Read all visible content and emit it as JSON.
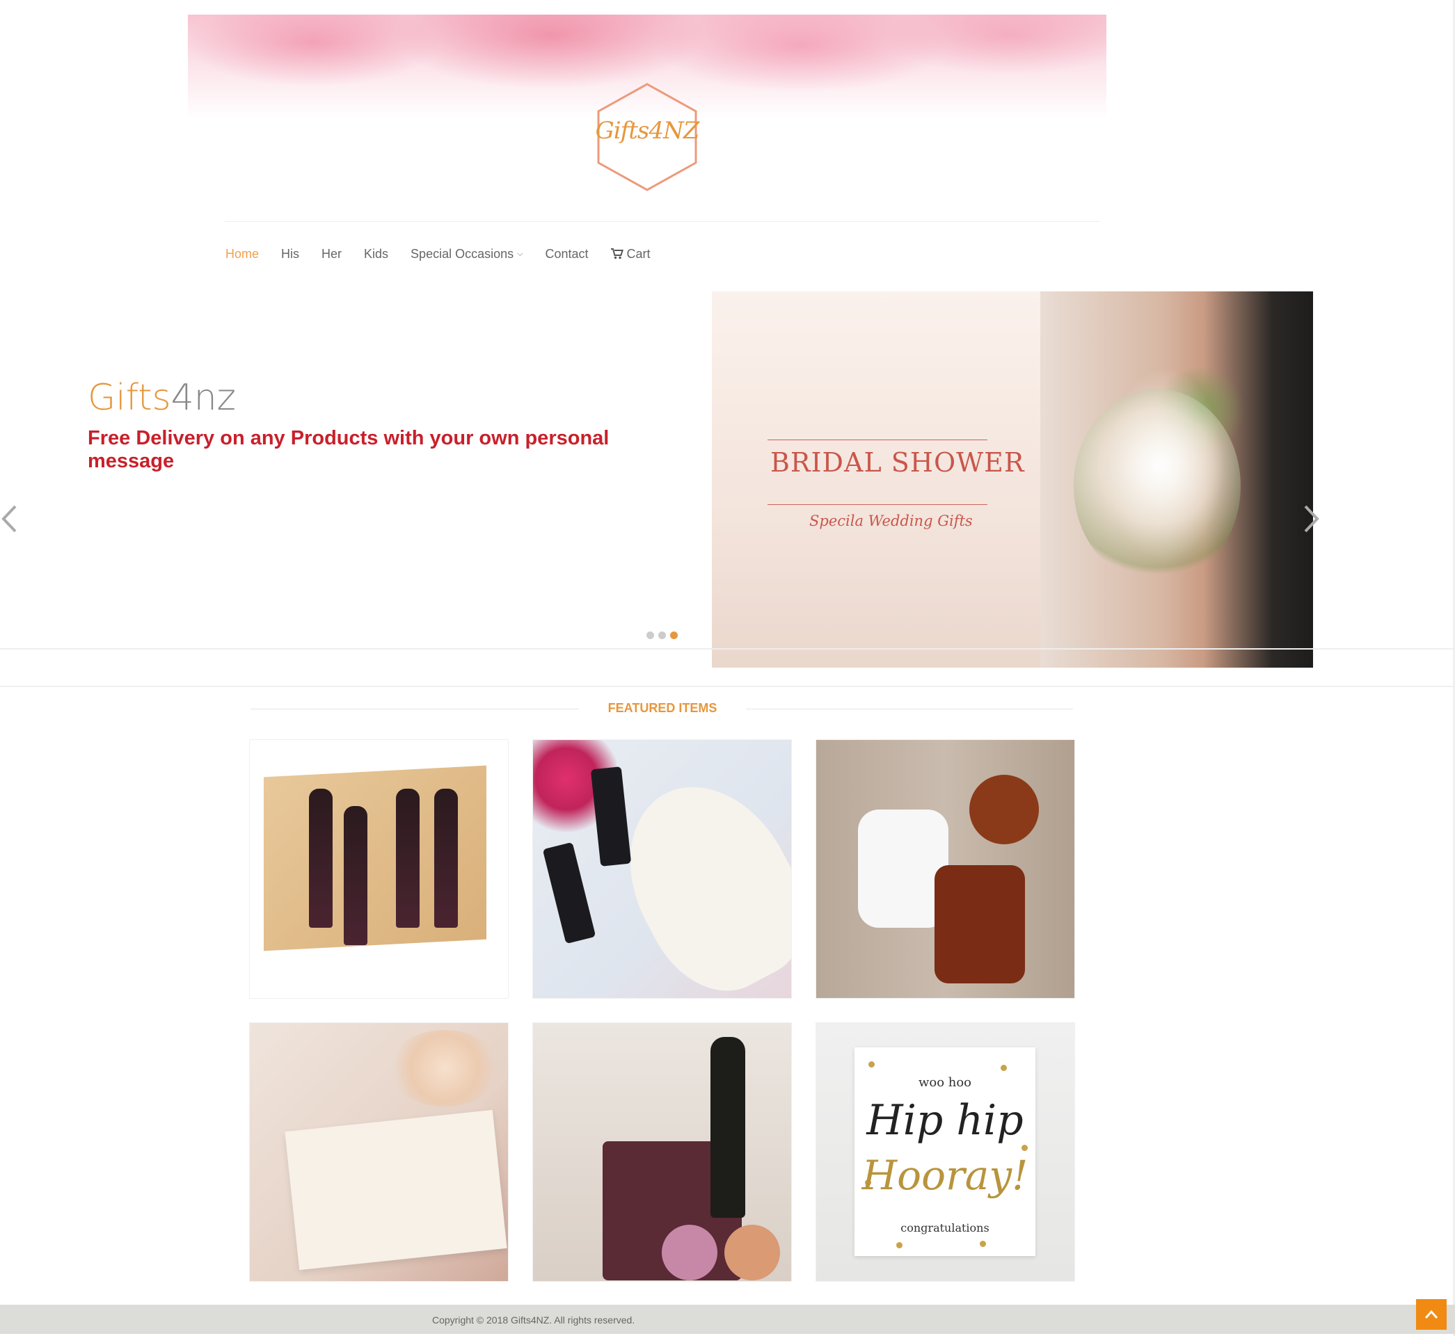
{
  "header": {
    "logo_text": "Gifts4NZ"
  },
  "nav": {
    "items": [
      {
        "label": "Home",
        "active": true
      },
      {
        "label": "His",
        "active": false
      },
      {
        "label": "Her",
        "active": false
      },
      {
        "label": "Kids",
        "active": false
      },
      {
        "label": "Special Occasions",
        "active": false,
        "has_dropdown": true
      },
      {
        "label": "Contact",
        "active": false
      },
      {
        "label": "Cart",
        "active": false,
        "icon": "cart-icon"
      }
    ],
    "active_color": "#e6973d"
  },
  "slider": {
    "brand_part1": "Gifts",
    "brand_part2": "4nz",
    "subtitle": "Free Delivery on any Products with your own personal message",
    "hero_title": "BRIDAL SHOWER",
    "hero_subtitle": "Specila Wedding Gifts",
    "slide_count": 3,
    "active_slide": 3,
    "prev_icon": "chevron-left-icon",
    "next_icon": "chevron-right-icon"
  },
  "featured": {
    "title": "FEATURED ITEMS",
    "items": [
      {
        "image": "wine-gift-box"
      },
      {
        "image": "karen-murrell-gift-set"
      },
      {
        "image": "baby-clothes-set"
      },
      {
        "image": "wedding-invitation-roses"
      },
      {
        "image": "luxury-hamper-champagne"
      },
      {
        "image": "hip-hip-hooray-card"
      }
    ],
    "card_text": {
      "line1": "woo hoo",
      "line2": "Hip hip",
      "line3": "Hooray!",
      "line4": "congratulations"
    }
  },
  "footer": {
    "copyright": "Copyright © 2018 Gifts4NZ. All rights reserved."
  },
  "colors": {
    "accent": "#e6973d",
    "subtitle_red": "#c8202b",
    "scroll_top": "#f08a12"
  }
}
